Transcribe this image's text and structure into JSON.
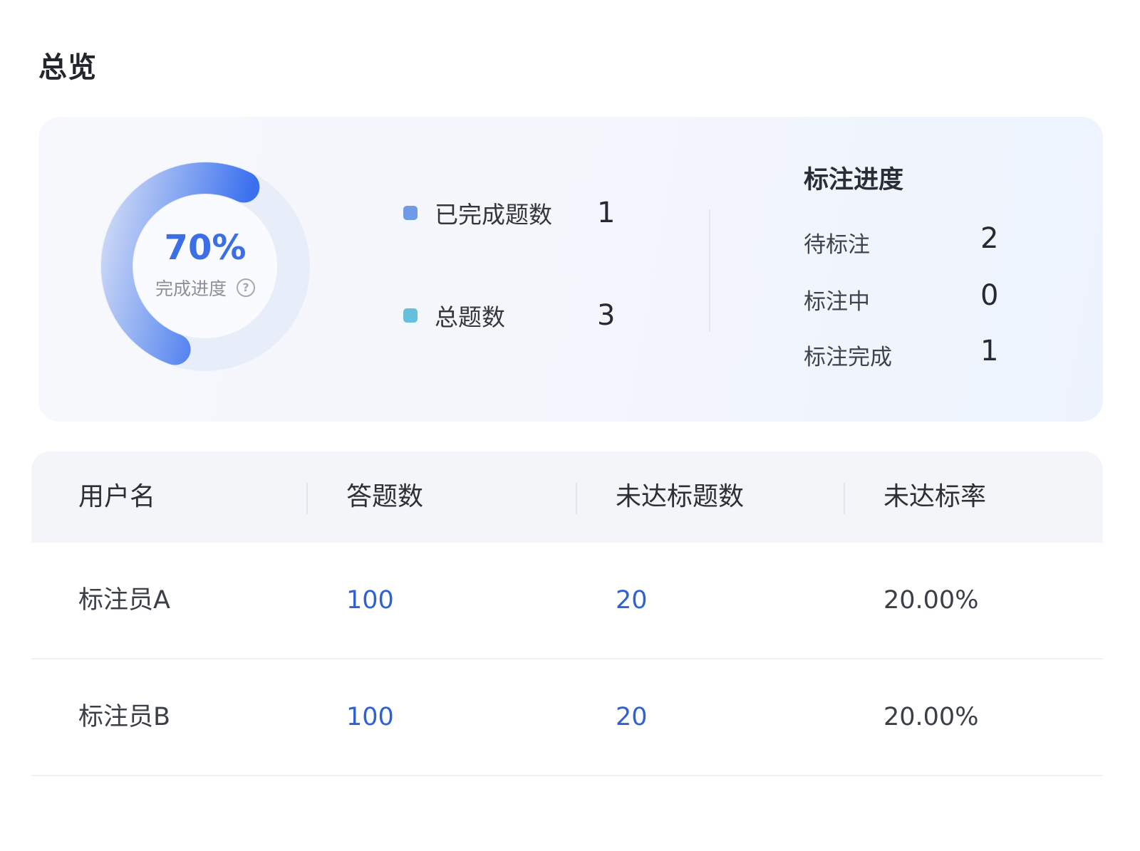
{
  "page": {
    "title": "总览"
  },
  "donut": {
    "percent_text": "70%",
    "progress": 0.7,
    "label": "完成进度",
    "help_glyph": "?"
  },
  "legend": [
    {
      "label": "已完成题数",
      "value": "1",
      "color": "#6f9ae8"
    },
    {
      "label": "总题数",
      "value": "3",
      "color": "#65c0de"
    }
  ],
  "labeling_progress": {
    "title": "标注进度",
    "items": [
      {
        "label": "待标注",
        "value": "2"
      },
      {
        "label": "标注中",
        "value": "0"
      },
      {
        "label": "标注完成",
        "value": "1"
      }
    ]
  },
  "table": {
    "headers": [
      "用户名",
      "答题数",
      "未达标题数",
      "未达标率"
    ],
    "rows": [
      {
        "name": "标注员A",
        "answered": "100",
        "failed": "20",
        "fail_rate": "20.00%"
      },
      {
        "name": "标注员B",
        "answered": "100",
        "failed": "20",
        "fail_rate": "20.00%"
      }
    ]
  },
  "colors": {
    "accent": "#3c6fe6",
    "link": "#2f61d6",
    "ring_track": "#e6ecfa"
  },
  "icons": {
    "help": "question-circle-icon"
  }
}
